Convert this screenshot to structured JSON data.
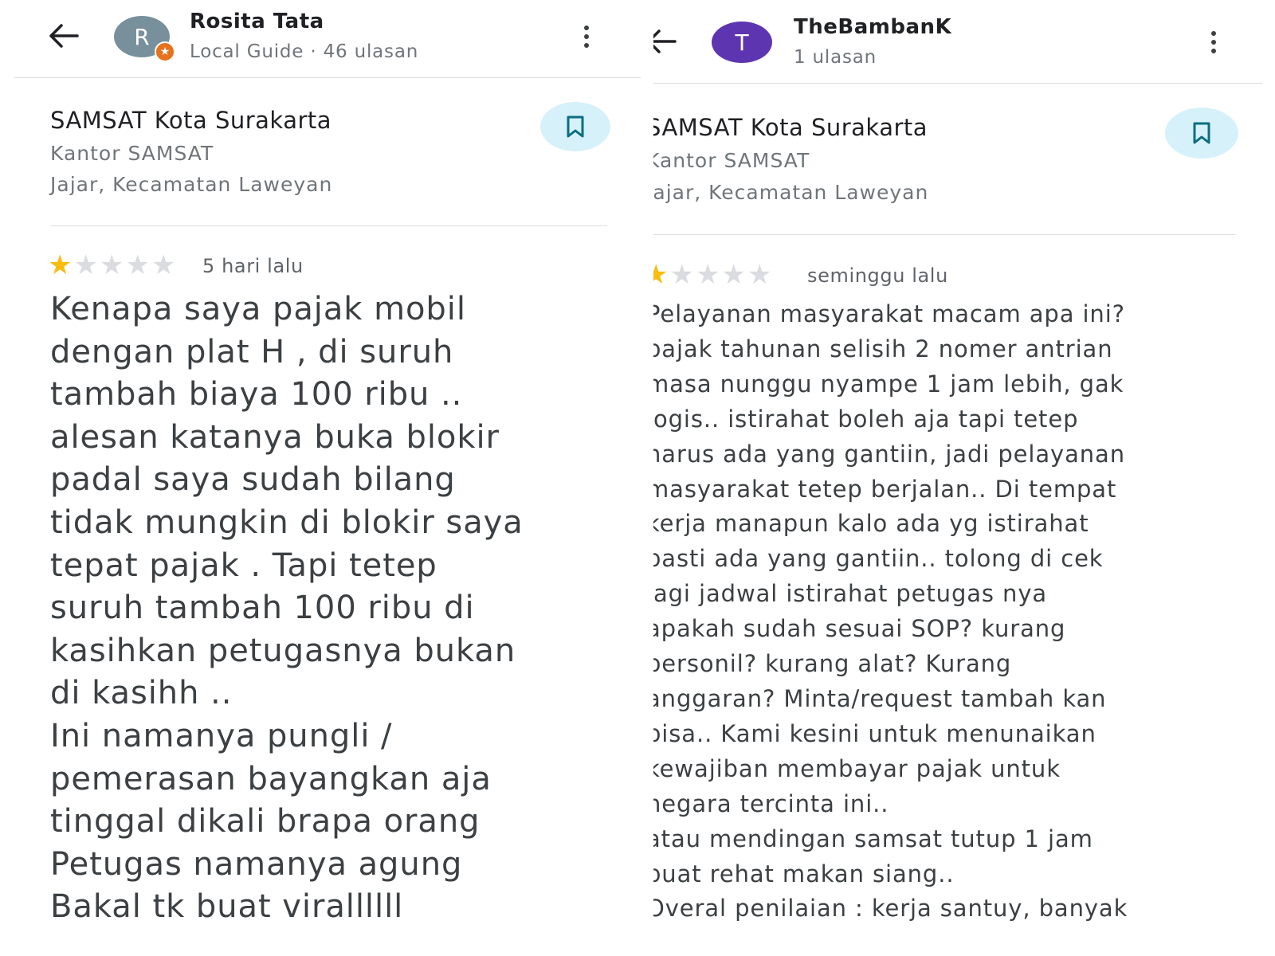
{
  "left_review": {
    "reviewer": {
      "name": "Rosita Tata",
      "subtitle": "Local Guide · 46 ulasan",
      "avatar_initial": "R",
      "avatar_color": "#78909c",
      "badge_icon": "local-guide-star-icon",
      "badge_glyph": "★"
    },
    "place": {
      "name": "SAMSAT Kota Surakarta",
      "category": "Kantor SAMSAT",
      "address": "Jajar, Kecamatan Laweyan"
    },
    "rating": 1,
    "max_rating": 5,
    "date": "5 hari lalu",
    "text": "Kenapa saya pajak mobil\ndengan plat H , di suruh\ntambah biaya 100 ribu ..\nalesan katanya buka blokir\npadal saya sudah bilang\ntidak mungkin di blokir saya\ntepat pajak .  Tapi tetep\nsuruh tambah 100 ribu  di\nkasihkan petugasnya bukan\ndi kasihh ..\nIni namanya pungli /\npemerasan bayangkan aja\ntinggal dikali brapa orang\nPetugas namanya agung\nBakal tk buat virallllll"
  },
  "right_review": {
    "reviewer": {
      "name": "TheBambanK",
      "subtitle": "1 ulasan",
      "avatar_initial": "T",
      "avatar_color": "#5e35b1"
    },
    "place": {
      "name": "SAMSAT Kota Surakarta",
      "category": "Kantor SAMSAT",
      "address": "Jajar, Kecamatan Laweyan"
    },
    "rating": 1,
    "max_rating": 5,
    "date": "seminggu lalu",
    "text": "Pelayanan masyarakat macam apa ini?\npajak tahunan selisih 2 nomer antrian\nmasa nunggu nyampe 1 jam lebih, gak\nlogis.. istirahat boleh aja tapi tetep\nharus ada yang gantiin, jadi pelayanan\nmasyarakat tetep berjalan.. Di tempat\nkerja manapun kalo ada yg istirahat\npasti ada yang gantiin.. tolong di cek\nlagi jadwal istirahat petugas nya\napakah sudah sesuai SOP? kurang\npersonil? kurang alat? Kurang\nanggaran? Minta/request tambah kan\nbisa.. Kami kesini untuk menunaikan\nkewajiban membayar pajak untuk\nnegara tercinta ini..\natau mendingan samsat tutup 1 jam\nbuat rehat makan siang..\nOveral penilaian : kerja santuy, banyak"
  },
  "icons": {
    "back": "arrow-left-icon",
    "more": "more-vert-icon",
    "save": "bookmark-icon",
    "star": "star-icon"
  },
  "colors": {
    "star_on": "#f9bd12",
    "star_off": "#dadce0",
    "save_bg": "#d6f1fa",
    "save_icon": "#0b6e80",
    "divider": "#dadce0"
  }
}
